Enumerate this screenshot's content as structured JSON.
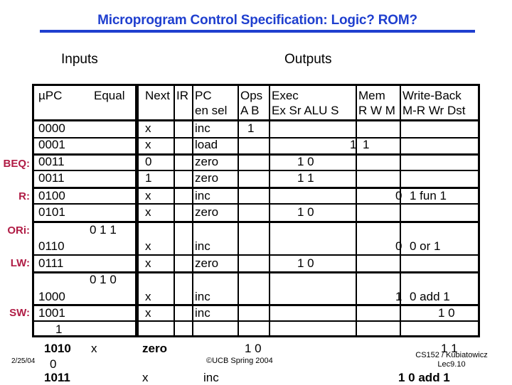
{
  "slide": {
    "title": "Microprogram Control Specification: Logic? ROM?",
    "accent_color": "#1F3FCF",
    "label_color": "#B01C45"
  },
  "captions": {
    "inputs": "Inputs",
    "outputs": "Outputs"
  },
  "table": {
    "headers": {
      "upc": "µPC",
      "equal": "Equal",
      "next": "Next",
      "ir": "IR",
      "pc_top": "PC",
      "pc_bottom": "en sel",
      "ops_top": "Ops",
      "ops_bottom": "A B",
      "exec_top": "Exec",
      "exec_bottom": "Ex Sr ALU S",
      "mem_top": "Mem",
      "mem_bottom": "R W M",
      "wb_top": "Write-Back",
      "wb_bottom": "M-R Wr Dst"
    },
    "rows": [
      {
        "label": "",
        "upc": "0000",
        "equal": "",
        "next": "x",
        "ir": "",
        "pc": "inc",
        "ops": "1",
        "exec": "",
        "mem": "",
        "wb": ""
      },
      {
        "label": "",
        "upc": "0001",
        "equal": "",
        "next": "x",
        "ir": "",
        "pc": "load",
        "ops": "",
        "exec": "",
        "mem_clip": "1",
        "mem": "1",
        "wb": ""
      },
      {
        "label": "BEQ:",
        "upc": "0011",
        "equal": "",
        "next": "0",
        "ir": "",
        "pc": "zero",
        "ops": "",
        "exec": "1   0",
        "mem": "",
        "wb": ""
      },
      {
        "label": "",
        "upc": "0011",
        "equal": "",
        "next": "1",
        "ir": "",
        "pc": "zero",
        "ops": "",
        "exec": "1   1",
        "mem": "",
        "wb": ""
      },
      {
        "label": "R:",
        "upc": "0100",
        "equal": "",
        "next": "x",
        "ir": "",
        "pc": "inc",
        "ops": "",
        "exec": "",
        "mem": "0",
        "wb": "1  fun  1"
      },
      {
        "label": "",
        "upc": "0101",
        "equal": "",
        "next": "x",
        "ir": "",
        "pc": "zero",
        "ops": "",
        "exec": "1   0",
        "mem": "",
        "wb": ""
      },
      {
        "label": "ORi:",
        "upc": "",
        "equal": "0   1   1",
        "next": "",
        "ir": "",
        "pc": "",
        "ops": "",
        "exec": "",
        "mem": "",
        "wb": ""
      },
      {
        "label": "",
        "upc": "0110",
        "equal": "",
        "next": "x",
        "ir": "",
        "pc": "inc",
        "ops": "",
        "exec": "",
        "mem": "0",
        "wb": "0   or   1"
      },
      {
        "label": "LW:",
        "upc": "0111",
        "equal": "",
        "next": "x",
        "ir": "",
        "pc": "zero",
        "ops": "",
        "exec": "1   0",
        "mem": "",
        "wb": ""
      },
      {
        "label": "",
        "upc": "",
        "equal": "0   1   0",
        "next": "",
        "ir": "",
        "pc": "",
        "ops": "",
        "exec": "",
        "mem": "",
        "wb": ""
      },
      {
        "label": "",
        "upc": "1000",
        "equal": "",
        "next": "x",
        "ir": "",
        "pc": "inc",
        "ops": "",
        "exec": "",
        "mem": "1",
        "wb": "0   add 1"
      },
      {
        "label": "SW:",
        "upc": "1001",
        "equal": "",
        "next": "x",
        "ir": "",
        "pc": "inc",
        "ops": "",
        "exec": "",
        "mem": "",
        "wb": "1  0"
      },
      {
        "label": "",
        "upc": "1",
        "equal": "",
        "next": "",
        "ir": "",
        "pc": "",
        "ops": "",
        "exec": "",
        "mem": "",
        "wb": ""
      }
    ],
    "overflow_rows": [
      {
        "upc": "1010",
        "equal": "x",
        "next": "zero",
        "exec": "1    0",
        "wb": "1     1"
      },
      {
        "upc": "0",
        "equal": "",
        "next": "",
        "exec": "",
        "wb": ""
      },
      {
        "upc": "1011",
        "equal": "",
        "next": "x",
        "exec": "inc",
        "wb": "1   0   add 1"
      }
    ]
  },
  "footer": {
    "date": "2/25/04",
    "copyright": "©UCB Spring 2004",
    "course": "CS152 / Kubiatowicz",
    "lecture": "Lec9.10"
  }
}
